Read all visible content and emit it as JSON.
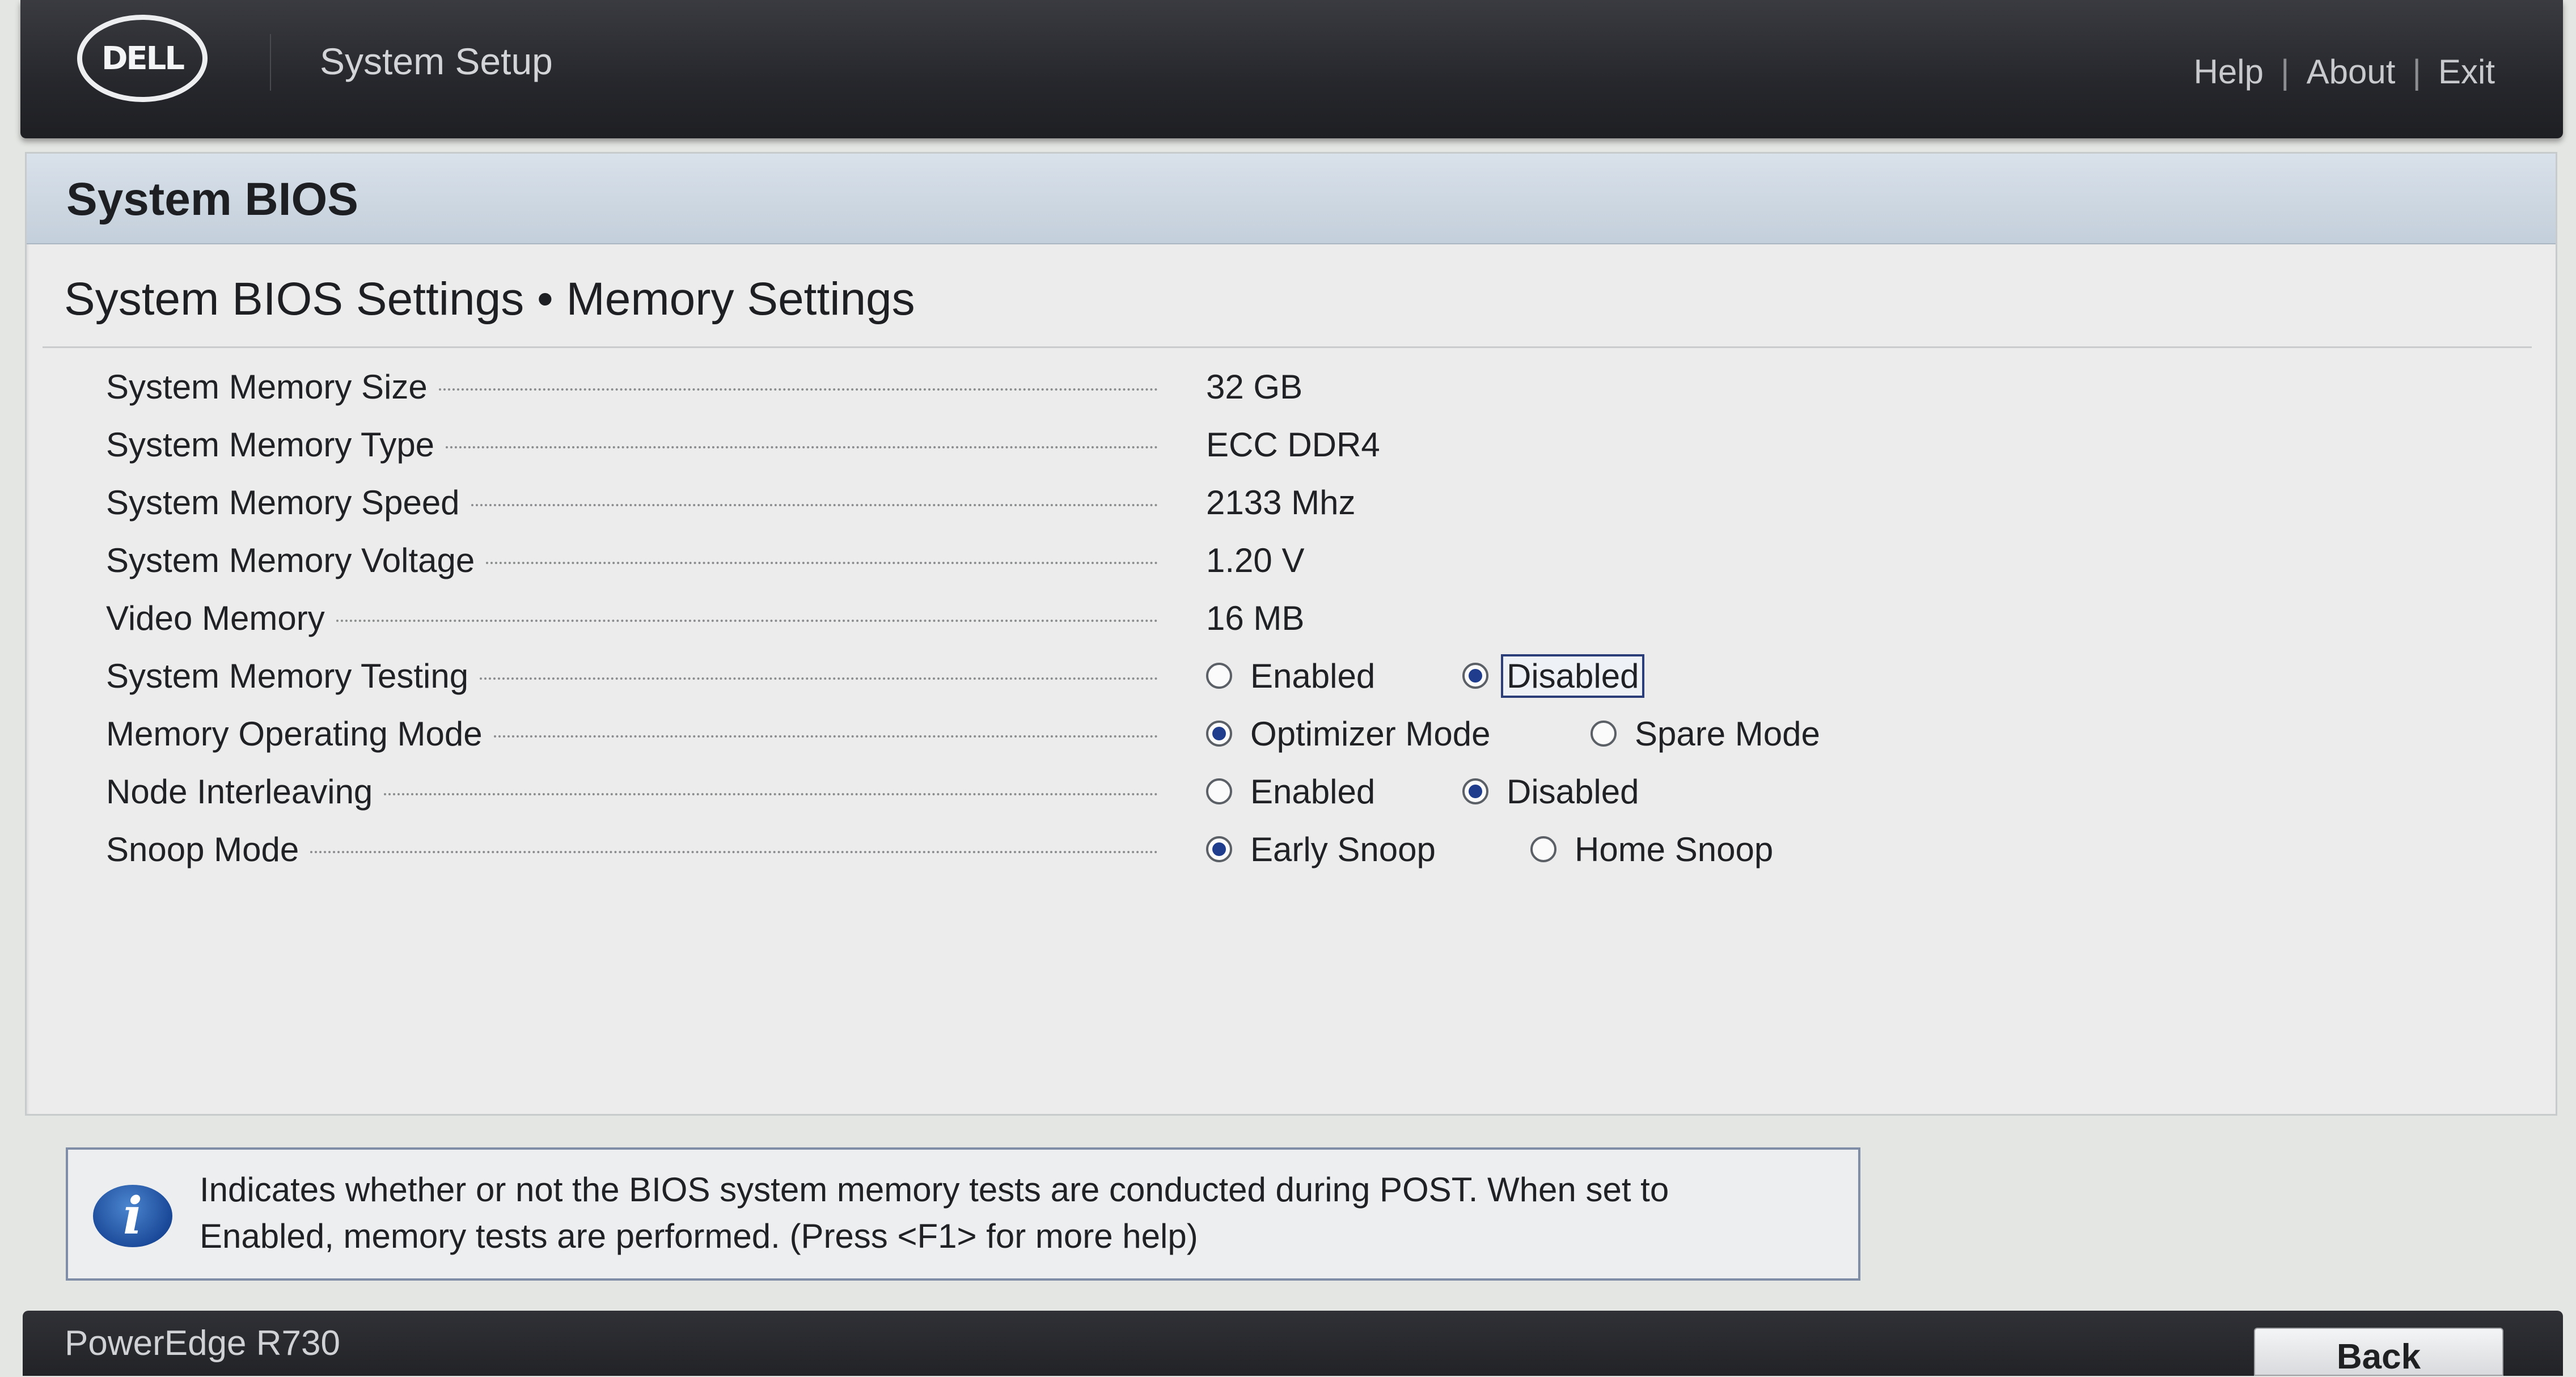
{
  "header": {
    "logo_text": "DELL",
    "app_title": "System Setup",
    "links": [
      "Help",
      "About",
      "Exit"
    ],
    "separator": "|"
  },
  "panel": {
    "title": "System BIOS",
    "breadcrumb": "System BIOS Settings • Memory Settings"
  },
  "settings": [
    {
      "label": "System Memory Size",
      "value": "32 GB"
    },
    {
      "label": "System Memory Type",
      "value": "ECC DDR4"
    },
    {
      "label": "System Memory Speed",
      "value": "2133 Mhz"
    },
    {
      "label": "System Memory Voltage",
      "value": "1.20 V"
    },
    {
      "label": "Video Memory",
      "value": "16 MB"
    },
    {
      "label": "System Memory Testing",
      "options": [
        "Enabled",
        "Disabled"
      ],
      "selected": "Disabled"
    },
    {
      "label": "Memory Operating Mode",
      "options": [
        "Optimizer Mode",
        "Spare Mode"
      ],
      "selected": "Optimizer Mode"
    },
    {
      "label": "Node Interleaving",
      "options": [
        "Enabled",
        "Disabled"
      ],
      "selected": "Disabled"
    },
    {
      "label": "Snoop Mode",
      "options": [
        "Early Snoop",
        "Home Snoop"
      ],
      "selected": "Early Snoop"
    }
  ],
  "help": {
    "icon": "info-icon",
    "text_line1": "Indicates whether or not the BIOS system memory tests are conducted during POST. When set to",
    "text_line2": "Enabled, memory tests are performed. (Press <F1> for more help)"
  },
  "footer": {
    "model": "PowerEdge R730",
    "back_label": "Back"
  },
  "colors": {
    "header_bg": "#26272c",
    "panel_header_bg": "#c3cfdb",
    "radio_selected": "#1f3d8c",
    "info_icon": "#1b4a9a"
  }
}
